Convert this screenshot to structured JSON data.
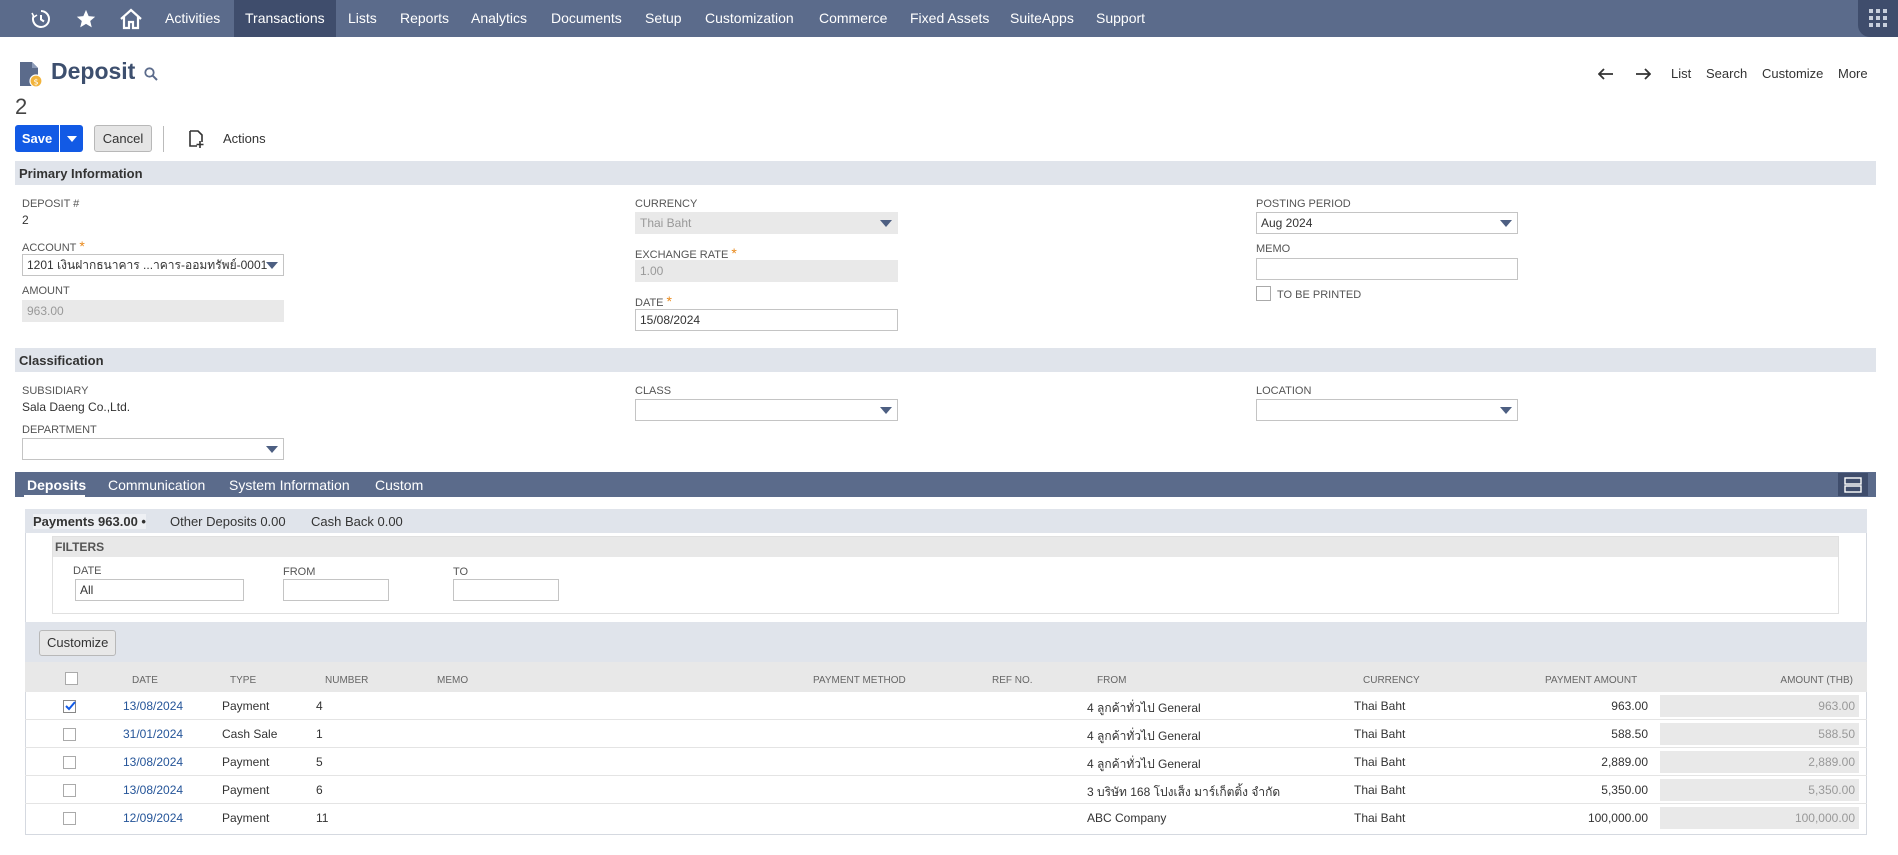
{
  "nav": {
    "items": [
      "Activities",
      "Transactions",
      "Lists",
      "Reports",
      "Analytics",
      "Documents",
      "Setup",
      "Customization",
      "Commerce",
      "Fixed Assets",
      "SuiteApps",
      "Support"
    ],
    "active": "Transactions"
  },
  "header": {
    "title": "Deposit",
    "record_number": "2",
    "links": {
      "list": "List",
      "search": "Search",
      "customize": "Customize",
      "more": "More"
    }
  },
  "toolbar": {
    "save_label": "Save",
    "cancel_label": "Cancel",
    "actions_label": "Actions"
  },
  "primary": {
    "section_title": "Primary Information",
    "deposit_no_label": "DEPOSIT #",
    "deposit_no": "2",
    "account_label": "ACCOUNT",
    "account_value": "1201 เงินฝากธนาคาร ...าคาร-ออมทรัพย์-0001",
    "amount_label": "AMOUNT",
    "amount_value": "963.00",
    "currency_label": "CURRENCY",
    "currency_value": "Thai Baht",
    "exchange_rate_label": "EXCHANGE RATE",
    "exchange_rate_value": "1.00",
    "date_label": "DATE",
    "date_value": "15/08/2024",
    "posting_period_label": "POSTING PERIOD",
    "posting_period_value": "Aug 2024",
    "memo_label": "MEMO",
    "memo_value": "",
    "to_be_printed_label": "TO BE PRINTED"
  },
  "classification": {
    "section_title": "Classification",
    "subsidiary_label": "SUBSIDIARY",
    "subsidiary_value": "Sala Daeng Co.,Ltd.",
    "department_label": "DEPARTMENT",
    "class_label": "CLASS",
    "location_label": "LOCATION"
  },
  "tabs": [
    "Deposits",
    "Communication",
    "System Information",
    "Custom"
  ],
  "subtabs": [
    "Payments 963.00 •",
    "Other Deposits 0.00",
    "Cash Back 0.00"
  ],
  "filters": {
    "title": "FILTERS",
    "date_label": "DATE",
    "date_value": "All",
    "from_label": "FROM",
    "to_label": "TO"
  },
  "list": {
    "customize_label": "Customize",
    "columns": [
      "DATE",
      "TYPE",
      "NUMBER",
      "MEMO",
      "PAYMENT METHOD",
      "REF NO.",
      "FROM",
      "CURRENCY",
      "PAYMENT AMOUNT",
      "AMOUNT (THB)"
    ],
    "rows": [
      {
        "checked": true,
        "date": "13/08/2024",
        "type": "Payment",
        "number": "4",
        "from": "4 ลูกค้าทั่วไป General",
        "currency": "Thai Baht",
        "payment_amount": "963.00",
        "amount_thb": "963.00"
      },
      {
        "checked": false,
        "date": "31/01/2024",
        "type": "Cash Sale",
        "number": "1",
        "from": "4 ลูกค้าทั่วไป General",
        "currency": "Thai Baht",
        "payment_amount": "588.50",
        "amount_thb": "588.50"
      },
      {
        "checked": false,
        "date": "13/08/2024",
        "type": "Payment",
        "number": "5",
        "from": "4 ลูกค้าทั่วไป General",
        "currency": "Thai Baht",
        "payment_amount": "2,889.00",
        "amount_thb": "2,889.00"
      },
      {
        "checked": false,
        "date": "13/08/2024",
        "type": "Payment",
        "number": "6",
        "from": "3 บริษัท 168 โปงเส็ง มาร์เก็ตติ้ง จำกัด",
        "currency": "Thai Baht",
        "payment_amount": "5,350.00",
        "amount_thb": "5,350.00"
      },
      {
        "checked": false,
        "date": "12/09/2024",
        "type": "Payment",
        "number": "11",
        "from": "ABC Company",
        "currency": "Thai Baht",
        "payment_amount": "100,000.00",
        "amount_thb": "100,000.00"
      }
    ]
  },
  "colors": {
    "nav_bg": "#5b6b8b",
    "nav_active": "#3f4d6c",
    "primary_button": "#125ae5",
    "link": "#255599",
    "required": "#e8881a"
  }
}
